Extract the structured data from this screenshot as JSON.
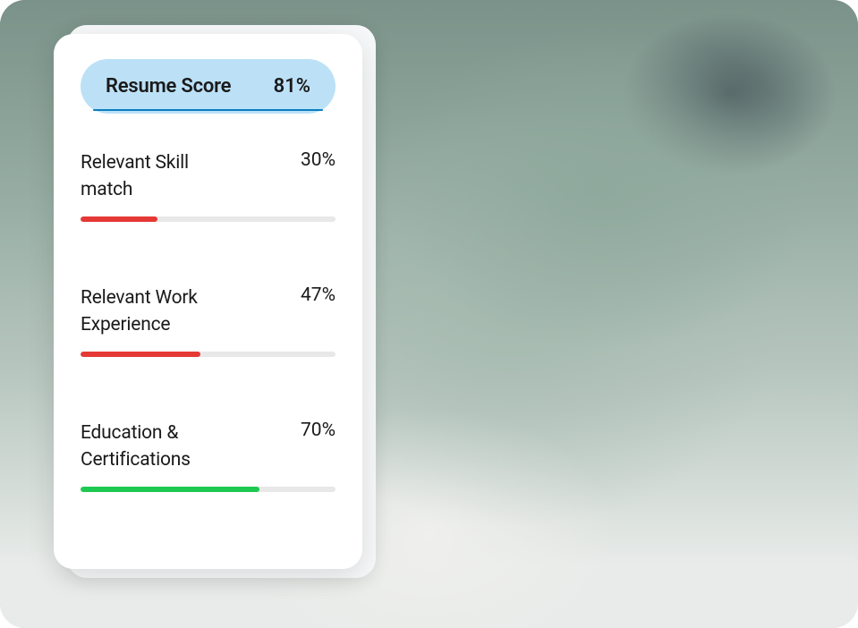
{
  "score": {
    "label": "Resume Score",
    "value": "81%"
  },
  "metrics": [
    {
      "label": "Relevant Skill match",
      "value": "30%",
      "percent": 30,
      "color": "red"
    },
    {
      "label": "Relevant Work Experience",
      "value": "47%",
      "percent": 47,
      "color": "red"
    },
    {
      "label": "Education & Certifications",
      "value": "70%",
      "percent": 70,
      "color": "green"
    }
  ]
}
